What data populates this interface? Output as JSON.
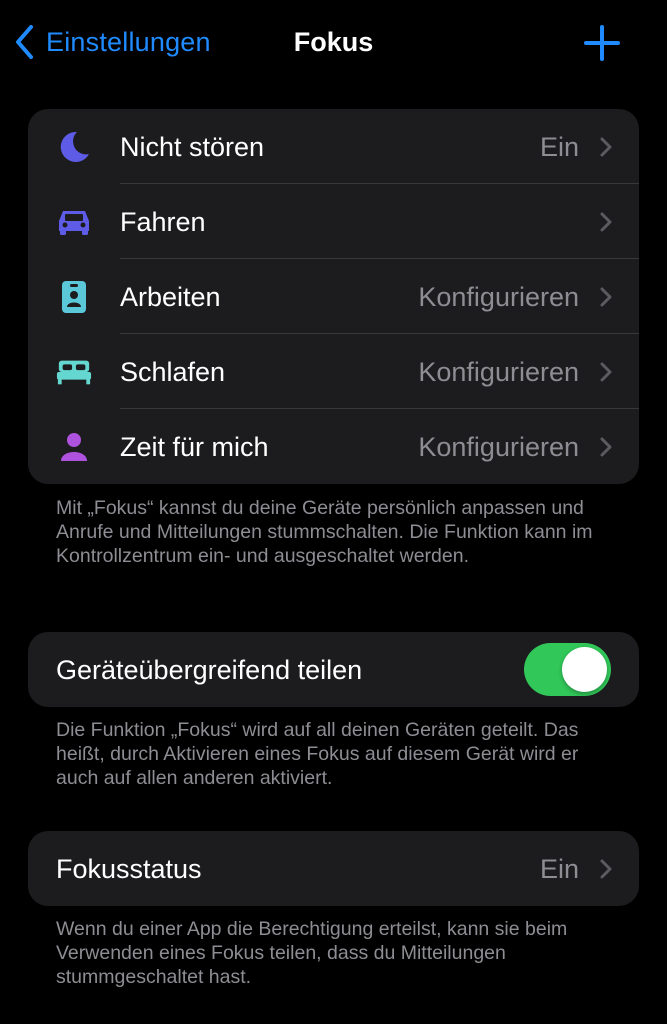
{
  "nav": {
    "back_label": "Einstellungen",
    "title": "Fokus",
    "accent": "#1f8bff"
  },
  "focus_modes": [
    {
      "label": "Nicht stören",
      "value": "Ein",
      "icon": "moon-icon",
      "icon_color": "#5e5ce6"
    },
    {
      "label": "Fahren",
      "value": "",
      "icon": "car-icon",
      "icon_color": "#5e5ce6"
    },
    {
      "label": "Arbeiten",
      "value": "Konfigurieren",
      "icon": "id-badge-icon",
      "icon_color": "#5ac8d8"
    },
    {
      "label": "Schlafen",
      "value": "Konfigurieren",
      "icon": "bed-icon",
      "icon_color": "#64d8d0"
    },
    {
      "label": "Zeit für mich",
      "value": "Konfigurieren",
      "icon": "person-icon",
      "icon_color": "#af52de"
    }
  ],
  "focus_footnote": "Mit „Fokus“ kannst du deine Geräte persönlich anpassen und Anrufe und Mitteilungen stummschalten. Die Funktion kann im Kontrollzentrum ein- und ausgeschaltet werden.",
  "share": {
    "label": "Geräteübergreifend teilen",
    "enabled": true,
    "toggle_color": "#31c759",
    "footnote": "Die Funktion „Fokus“ wird auf all deinen Geräten geteilt. Das heißt, durch Aktivieren eines Fokus auf diesem Gerät wird er auch auf allen anderen aktiviert."
  },
  "status": {
    "label": "Fokusstatus",
    "value": "Ein",
    "footnote": "Wenn du einer App die Berechtigung erteilst, kann sie beim Verwenden eines Fokus teilen, dass du Mitteilungen stummgeschaltet hast."
  }
}
